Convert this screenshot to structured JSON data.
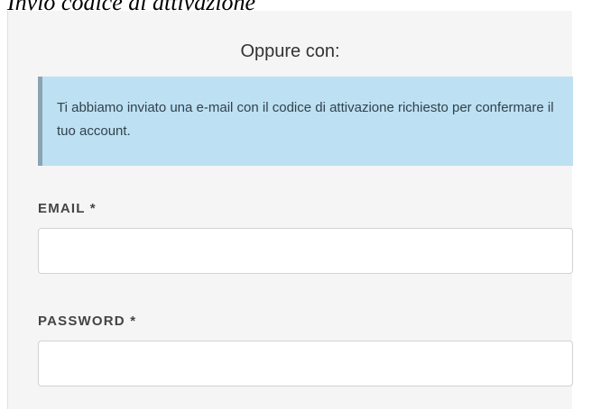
{
  "page": {
    "heading": "Invio codice di attivazione"
  },
  "panel": {
    "title": "Oppure con:"
  },
  "alert": {
    "message": "Ti abbiamo inviato una e-mail con il codice di attivazione richiesto per confermare il tuo account."
  },
  "form": {
    "email_label": "EMAIL *",
    "email_value": "",
    "password_label": "PASSWORD *",
    "password_value": ""
  },
  "colors": {
    "panel_background": "#f5f5f5",
    "alert_background": "#bde0f3",
    "alert_border": "#8aa4b3",
    "input_border": "#d2d2d2"
  }
}
